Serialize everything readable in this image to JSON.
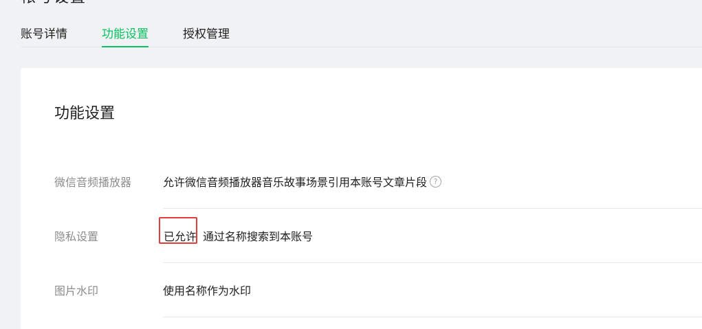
{
  "page_heading": "帐号设置",
  "tabs": [
    {
      "label": "账号详情"
    },
    {
      "label": "功能设置"
    },
    {
      "label": "授权管理"
    }
  ],
  "active_tab_index": 1,
  "card": {
    "title": "功能设置",
    "rows": [
      {
        "label": "微信音频播放器",
        "value": "允许微信音频播放器音乐故事场景引用本账号文章片段",
        "help_icon": "?"
      },
      {
        "label": "隐私设置",
        "status": "已允许",
        "value": "通过名称搜索到本账号"
      },
      {
        "label": "图片水印",
        "value": "使用名称作为水印"
      }
    ]
  },
  "colors": {
    "accent_green": "#07c160",
    "highlight_red": "#e03c3c",
    "label_gray": "#8c8c8c"
  }
}
